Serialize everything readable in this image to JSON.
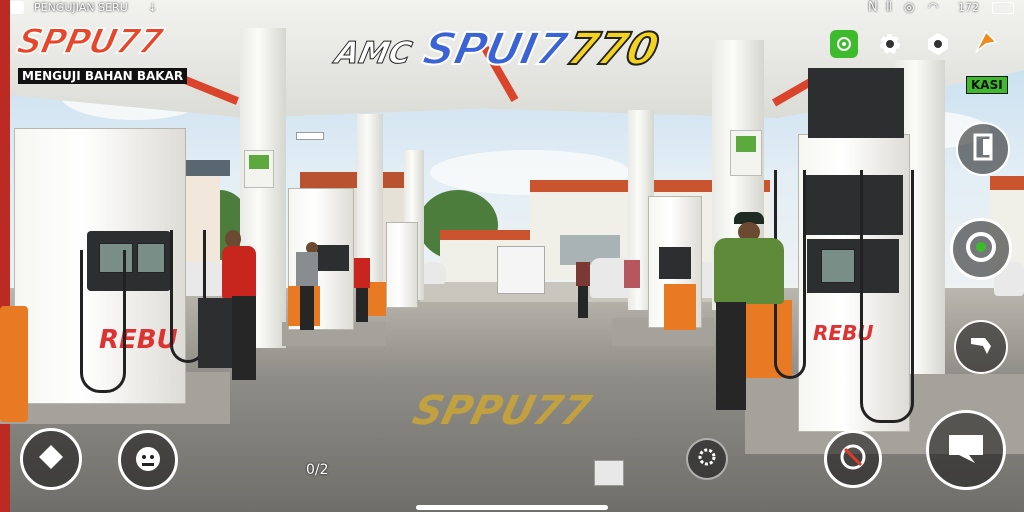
{
  "status_bar": {
    "left_label": "PENGUJIAN SERU",
    "battery_text": "172"
  },
  "hud": {
    "game_logo": "SPPU77",
    "game_subtitle": "MENGUJI BAHAN BAKAR",
    "banner_prefix": "AMC",
    "banner_title_a": "SPUI7",
    "banner_title_b": "770",
    "mini_label": "KASI",
    "counter_text": "0/2",
    "accent_colors": {
      "logo_fill": "#e8462a",
      "banner_blue": "#3a63d6",
      "banner_yellow": "#f4d320",
      "green_icon": "#3dbb2c",
      "orange_icon": "#f08a1c"
    }
  },
  "scene": {
    "pump_left_brand": "REBU",
    "pump_right_brand": "REBU",
    "floor_mark": "SPPU77"
  },
  "icons": {
    "status_left": "app-icon",
    "status_right": [
      "nfc-icon",
      "vibrate-icon",
      "wifi-icon",
      "battery-icon"
    ],
    "top_right": [
      "camera-icon",
      "settings-gear-icon",
      "hexagon-icon",
      "boost-icon"
    ],
    "right_column": [
      "door-icon",
      "steering-wheel-icon",
      "fuel-nozzle-icon",
      "chat-icon"
    ],
    "bottom": [
      "diamond-icon",
      "face-icon",
      "gear-badge-icon",
      "no-entry-icon"
    ]
  }
}
